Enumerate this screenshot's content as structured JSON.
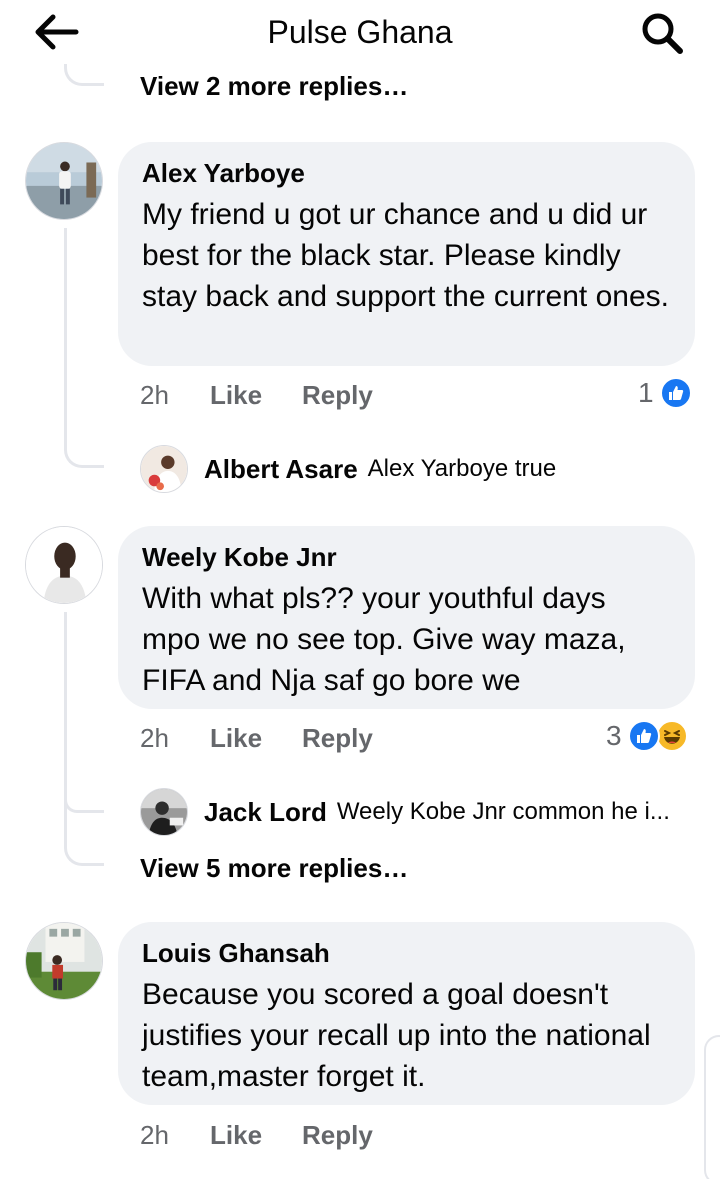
{
  "header": {
    "title": "Pulse Ghana",
    "back_icon": "arrow-left-icon",
    "search_icon": "search-icon"
  },
  "top_view_more": "View 2 more replies…",
  "comments": [
    {
      "author": "Alex Yarboye",
      "text": "My friend u got ur chance and u did ur best for the black star.  Please kindly stay back and support the current ones.",
      "time": "2h",
      "like": "Like",
      "reply": "Reply",
      "reaction_count": "1",
      "reactions": [
        "like"
      ],
      "replies": [
        {
          "author": "Albert Asare",
          "text": "Alex Yarboye true"
        }
      ]
    },
    {
      "author": "Weely Kobe Jnr",
      "text": "With what pls?? your youthful days mpo we no see top. Give way maza, FIFA and Nja saf go bore we",
      "time": "2h",
      "like": "Like",
      "reply": "Reply",
      "reaction_count": "3",
      "reactions": [
        "like",
        "haha"
      ],
      "replies": [
        {
          "author": "Jack Lord",
          "text": "Weely Kobe Jnr common he i..."
        }
      ],
      "view_more": "View 5 more replies…"
    },
    {
      "author": "Louis Ghansah",
      "text": "Because you scored a goal doesn't justifies your recall up into the national team,master forget it.",
      "time": "2h",
      "like": "Like",
      "reply": "Reply"
    }
  ],
  "colors": {
    "bubble": "#f0f2f5",
    "muted_text": "#65676b",
    "like_blue": "#1877f2",
    "haha_yellow": "#f7b928"
  }
}
